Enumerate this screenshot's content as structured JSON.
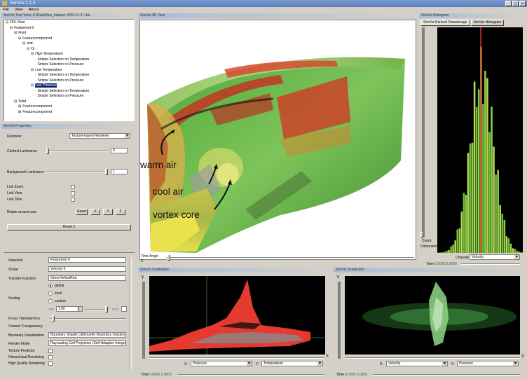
{
  "window": {
    "title": "SimVis 2.1.4",
    "minimize": "_",
    "maximize": "□",
    "close": "×"
  },
  "menu": [
    "File",
    "View",
    "About"
  ],
  "tree_panel": {
    "header": "SimVis Tree View: C:/Data/flow_dataset-2006-11-27.dat",
    "items": [
      {
        "label": "FDL Root",
        "indent": 0,
        "prefix": "⊟"
      },
      {
        "label": "Featureset 0",
        "indent": 1,
        "prefix": "⊟"
      },
      {
        "label": "Fluid",
        "indent": 2,
        "prefix": "⊟"
      },
      {
        "label": "Featurecomponent",
        "indent": 3,
        "prefix": "⊟"
      },
      {
        "label": "and",
        "indent": 4,
        "prefix": "⊟"
      },
      {
        "label": "Or",
        "indent": 5,
        "prefix": "⊟"
      },
      {
        "label": "High Temperature",
        "indent": 6,
        "prefix": "⊟"
      },
      {
        "label": "Simple Selection on Temperature",
        "indent": 7,
        "prefix": "·"
      },
      {
        "label": "Simple Selection on Pressure",
        "indent": 7,
        "prefix": "·"
      },
      {
        "label": "Low Temperature",
        "indent": 6,
        "prefix": "⊟"
      },
      {
        "label": "Simple Selection on Temperature",
        "indent": 7,
        "prefix": "·"
      },
      {
        "label": "Simple Selection on Pressure",
        "indent": 7,
        "prefix": "·"
      },
      {
        "label": "Low Pressure",
        "indent": 6,
        "prefix": "⊟",
        "selected": true
      },
      {
        "label": "Simple Selection on Temperature",
        "indent": 7,
        "prefix": "·"
      },
      {
        "label": "Simple Selection on Pressure",
        "indent": 7,
        "prefix": "·"
      },
      {
        "label": "Solid",
        "indent": 2,
        "prefix": "⊟"
      },
      {
        "label": "Featurecomponent",
        "indent": 3,
        "prefix": "⊞"
      },
      {
        "label": "Featurecomponent",
        "indent": 3,
        "prefix": "⊞"
      }
    ]
  },
  "properties": {
    "header": "SimVis Properties",
    "renderer_label": "Renderer",
    "renderer_value": "Texture-based Renderer",
    "context_label": "Context Luminance",
    "context_value": "0",
    "background_label": "Background Luminance",
    "background_value": "1",
    "link_zoom": "Link Zoom",
    "link_view": "Link View",
    "link_time": "Link Time",
    "rotate_label": "Rotate around axis",
    "reset_btn": "Reset",
    "x_btn": "X",
    "y_btn": "Y",
    "z_btn": "Z",
    "reset2_btn": "Reset 2",
    "selection_label": "Selection",
    "selection_value": "Featureset 0",
    "scalar_label": "Scalar",
    "scalar_value": "Velocity 0",
    "transfer_label": "Transfer Function",
    "transfer_value": "GreenYellowRed",
    "scaling_label": "Scaling",
    "opt_global": "global",
    "opt_local": "local",
    "opt_custom": "custom",
    "min_label": "min",
    "min_value": "1.00",
    "max_label": "max",
    "focus_label": "Focus Transparency",
    "context_trans_label": "Context Transparency",
    "boundary_label": "Boundary Visualization",
    "boundary_value": "Boundary Shader (Silhouette Boundary Shader)",
    "render_mode_label": "Render Mode",
    "render_mode_value": "Raycasting Cell Projection (Self-Adaptive Integration)",
    "texture_pred": "Texture Predictor",
    "hierarch": "Hierarchical Rendering",
    "hq": "High Quality Rendering"
  },
  "view3d": {
    "header": "SimVis 3D View",
    "annotations": [
      "warm air",
      "cool air",
      "vortex core"
    ],
    "time_label": "Time Angle",
    "time_value": "0"
  },
  "histogram": {
    "header": "SimVis Histogram",
    "tab1": "SimVis Derived Datastorage",
    "tab2": "SimVis Histogram",
    "count_label": "Count",
    "dim_label": "Dimension",
    "channel_label": "Channel",
    "channel_value": "Velocity",
    "time_label": "Time",
    "time_value": "0.0000  0.0000"
  },
  "scatter1": {
    "header": "SimVis Scatterplot",
    "y_axis": "Y",
    "x_axis": "X",
    "x_label": "X:",
    "x_value": "Pressure",
    "y_label": "Y:",
    "y_value": "Temperature",
    "time_label": "Time",
    "time_value": "0.0000  0.0000"
  },
  "scatter2": {
    "header": "SimVis Scatterplot",
    "y_axis": "Y",
    "x_axis": "X",
    "x_label": "X:",
    "x_value": "Velocity",
    "y_label": "Y:",
    "y_value": "Pressure",
    "time_label": "Time",
    "time_value": "0.0000  0.0000"
  }
}
